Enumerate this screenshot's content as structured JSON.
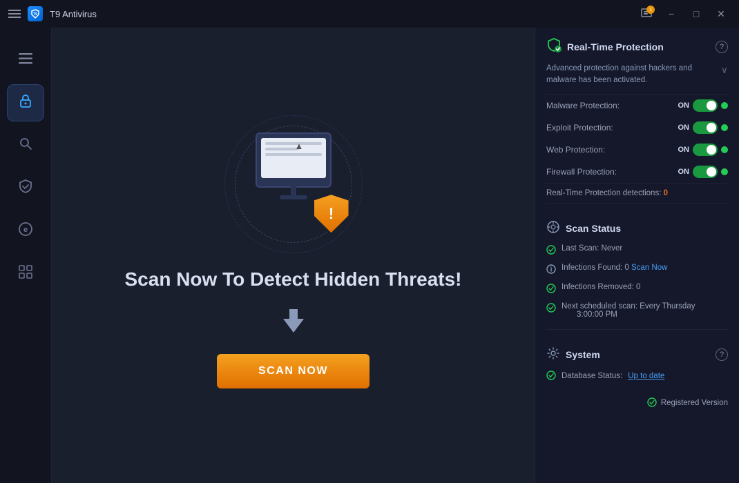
{
  "titleBar": {
    "appName": "T9 Antivirus",
    "notificationCount": "1",
    "minimizeLabel": "−",
    "maximizeLabel": "□",
    "closeLabel": "✕"
  },
  "sidebar": {
    "items": [
      {
        "id": "menu",
        "icon": "☰",
        "label": "Menu",
        "active": false
      },
      {
        "id": "protection",
        "icon": "🔒",
        "label": "Protection",
        "active": true
      },
      {
        "id": "scan",
        "icon": "🔍",
        "label": "Scan",
        "active": false
      },
      {
        "id": "shield",
        "icon": "🛡",
        "label": "Shield",
        "active": false
      },
      {
        "id": "privacy",
        "icon": "🅔",
        "label": "Privacy",
        "active": false
      },
      {
        "id": "apps",
        "icon": "⊞",
        "label": "Apps",
        "active": false
      }
    ]
  },
  "center": {
    "headline": "Scan Now To Detect Hidden Threats!",
    "scanButtonLabel": "SCAN NOW"
  },
  "rightPanel": {
    "realTimeProtection": {
      "title": "Real-Time Protection",
      "description": "Advanced protection against hackers and malware has been activated.",
      "protections": [
        {
          "label": "Malware Protection:",
          "status": "ON"
        },
        {
          "label": "Exploit Protection:",
          "status": "ON"
        },
        {
          "label": "Web Protection:",
          "status": "ON"
        },
        {
          "label": "Firewall Protection:",
          "status": "ON"
        }
      ],
      "detectionsLabel": "Real-Time Protection detections:",
      "detectionsCount": "0"
    },
    "scanStatus": {
      "title": "Scan Status",
      "lastScanLabel": "Last Scan:",
      "lastScanValue": "Never",
      "infectionsFoundLabel": "Infections Found: 0",
      "infectionsFoundLink": "Scan Now",
      "infectionsRemovedLabel": "Infections Removed: 0",
      "nextScanLabel": "Next scheduled scan: Every Thursday",
      "nextScanTime": "3:00:00 PM"
    },
    "system": {
      "title": "System",
      "dbStatusLabel": "Database Status:",
      "dbStatusLink": "Up to date"
    },
    "registeredLabel": "Registered Version"
  }
}
